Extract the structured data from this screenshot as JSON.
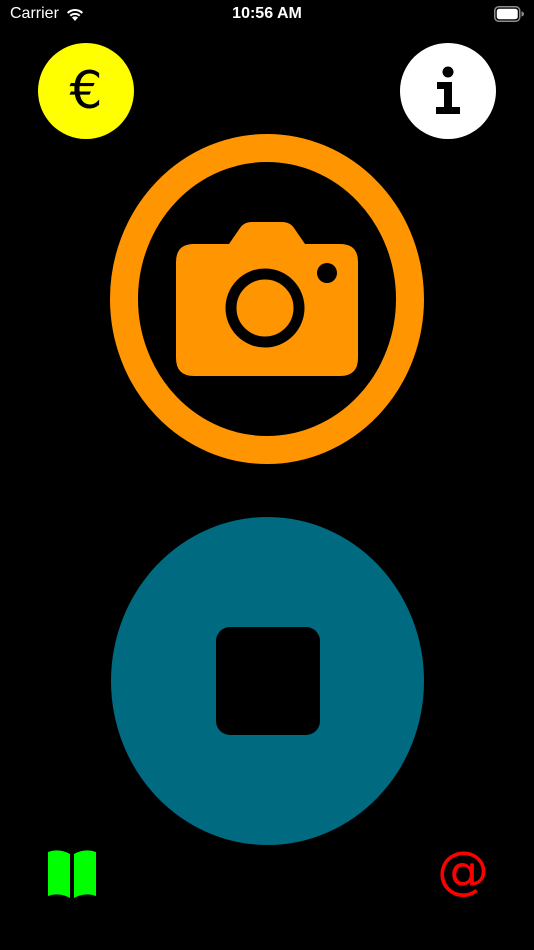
{
  "status_bar": {
    "carrier": "Carrier",
    "time": "10:56 AM",
    "icons": [
      "wifi-icon",
      "battery-icon"
    ]
  },
  "top_left": {
    "glyph": "€",
    "icon": "euro-icon",
    "color": "#FFFF00"
  },
  "top_right": {
    "glyph": "i",
    "icon": "info-icon",
    "color": "#FFFFFF"
  },
  "camera_button": {
    "icon": "camera-icon",
    "color": "#FF9500"
  },
  "stop_button": {
    "icon": "stop-icon",
    "color": "#006A80"
  },
  "bottom_left": {
    "icon": "book-icon",
    "color": "#00FF00"
  },
  "bottom_right": {
    "glyph": "@",
    "icon": "at-icon",
    "color": "#FF0000"
  },
  "colors": {
    "background": "#000000"
  }
}
